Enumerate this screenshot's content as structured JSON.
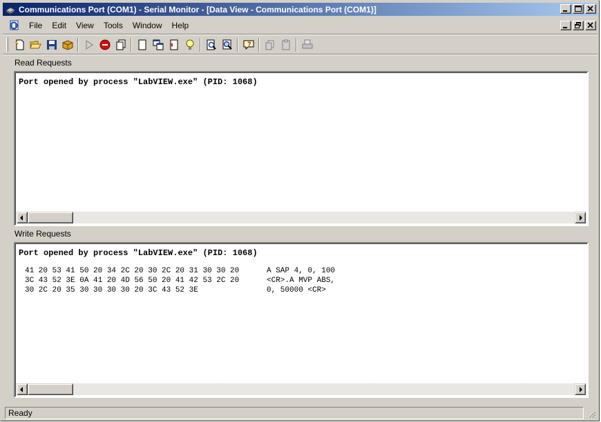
{
  "window": {
    "title": "Communications Port (COM1) - Serial Monitor - [Data View - Communications Port (COM1)]"
  },
  "menu": {
    "items": [
      "File",
      "Edit",
      "View",
      "Tools",
      "Window",
      "Help"
    ]
  },
  "toolbar": {
    "icons": [
      "new-document-icon",
      "open-folder-icon",
      "save-icon",
      "package-icon",
      "play-icon",
      "stop-icon",
      "copy-pages-icon",
      "document-icon",
      "windows-icon",
      "split-icon",
      "lightbulb-icon",
      "zoom-page-icon",
      "zoom-selection-icon",
      "help-balloon-icon",
      "disabled-copy-icon",
      "disabled-paste-icon",
      "disabled-print-icon"
    ]
  },
  "read_panel": {
    "label": "Read Requests",
    "line": "Port opened by process \"LabVIEW.exe\" (PID: 1068)"
  },
  "write_panel": {
    "label": "Write Requests",
    "line": "Port opened by process \"LabVIEW.exe\" (PID: 1068)",
    "rows": [
      {
        "hex": "41 20 53 41 50 20 34 2C 20 30 2C 20 31 30 30 20",
        "ascii": "A SAP 4, 0, 100"
      },
      {
        "hex": "3C 43 52 3E 0A 41 20 4D 56 50 20 41 42 53 2C 20",
        "ascii": "<CR>.A MVP ABS,"
      },
      {
        "hex": "30 2C 20 35 30 30 30 30 20 3C 43 52 3E",
        "ascii": "0, 50000 <CR>"
      }
    ]
  },
  "status": {
    "text": "Ready"
  }
}
